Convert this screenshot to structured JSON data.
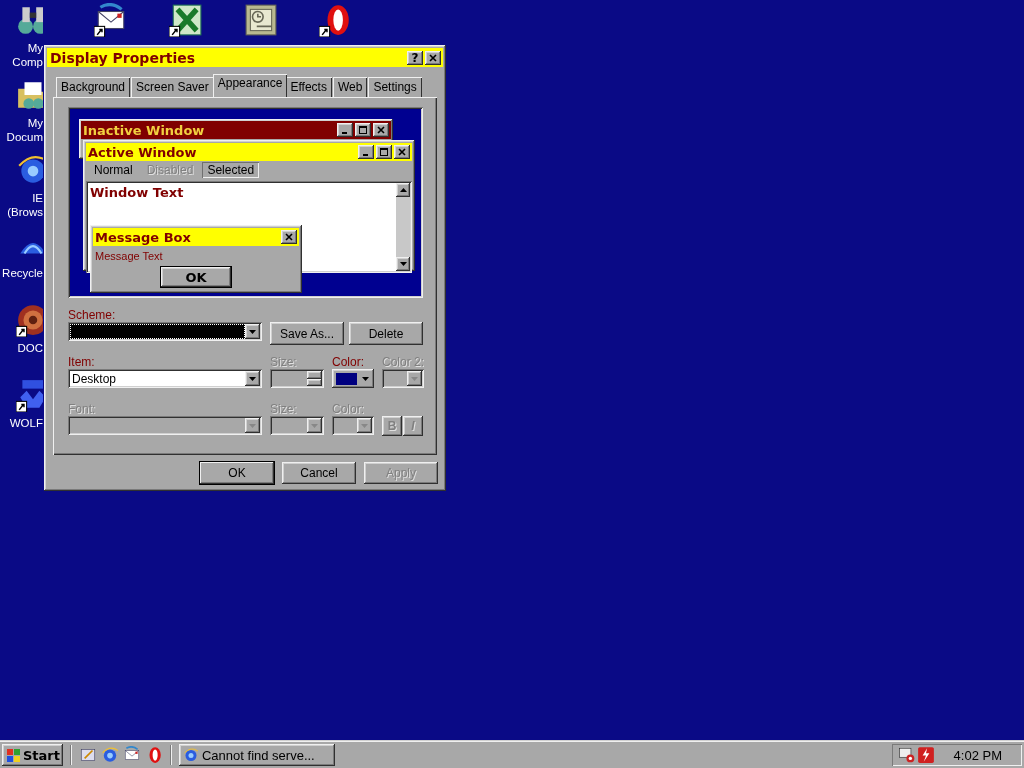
{
  "desktop": {
    "icons": [
      {
        "label": "My Comp",
        "kind": "binoculars",
        "shortcut": false
      },
      {
        "label": "My Docum",
        "kind": "folder",
        "shortcut": false
      },
      {
        "label": "IE (Brows",
        "kind": "ie",
        "shortcut": false
      },
      {
        "label": "Recycle",
        "kind": "recycle",
        "shortcut": false
      },
      {
        "label": "DOC",
        "kind": "doc",
        "shortcut": true
      },
      {
        "label": "WOLF",
        "kind": "wolf",
        "shortcut": true
      }
    ],
    "top_icons": [
      {
        "kind": "mail",
        "shortcut": true
      },
      {
        "kind": "excel",
        "shortcut": true
      },
      {
        "kind": "project",
        "shortcut": false
      },
      {
        "kind": "opera",
        "shortcut": true
      }
    ]
  },
  "dialog": {
    "title": "Display Properties",
    "help_button": "?",
    "tabs": [
      {
        "label": "Background",
        "selected": false
      },
      {
        "label": "Screen Saver",
        "selected": false
      },
      {
        "label": "Appearance",
        "selected": true
      },
      {
        "label": "Effects",
        "selected": false
      },
      {
        "label": "Web",
        "selected": false
      },
      {
        "label": "Settings",
        "selected": false
      }
    ],
    "preview": {
      "inactive_window": {
        "title": "Inactive Window"
      },
      "active_window": {
        "title": "Active Window",
        "menu": [
          {
            "label": "Normal",
            "disabled": false,
            "selected": false
          },
          {
            "label": "Disabled",
            "disabled": true,
            "selected": false
          },
          {
            "label": "Selected",
            "disabled": false,
            "selected": true
          }
        ],
        "window_text": "Window Text"
      },
      "message_box": {
        "title": "Message Box",
        "text": "Message Text",
        "button": "OK"
      }
    },
    "scheme": {
      "label": "Scheme:",
      "buttons": [
        "Save As...",
        "Delete"
      ]
    },
    "item": {
      "label": "Item:",
      "value": "Desktop",
      "disabled": false
    },
    "item_size": {
      "label": "Size:",
      "disabled": true
    },
    "item_color": {
      "label": "Color:",
      "disabled": false,
      "color": "#000080"
    },
    "item_color2": {
      "label": "Color 2:",
      "disabled": true
    },
    "font": {
      "label": "Font:",
      "disabled": true
    },
    "font_size": {
      "label": "Size:",
      "disabled": true
    },
    "font_color": {
      "label": "Color:",
      "disabled": true
    },
    "style_buttons": [
      {
        "label": "B",
        "kind": "bold",
        "disabled": true
      },
      {
        "label": "I",
        "kind": "italic",
        "disabled": true
      }
    ],
    "buttons": [
      {
        "label": "OK",
        "disabled": false
      },
      {
        "label": "Cancel",
        "disabled": false
      },
      {
        "label": "Apply",
        "disabled": true
      }
    ]
  },
  "taskbar": {
    "start": "Start",
    "quick_launch": [
      {
        "kind": "desktop"
      },
      {
        "kind": "ie"
      },
      {
        "kind": "mail"
      },
      {
        "kind": "opera"
      }
    ],
    "tasks": [
      {
        "label": "Cannot find serve...",
        "kind": "ie",
        "selected": false
      }
    ],
    "tray": [
      {
        "kind": "device"
      },
      {
        "kind": "alert"
      }
    ],
    "clock": "4:02 PM"
  }
}
